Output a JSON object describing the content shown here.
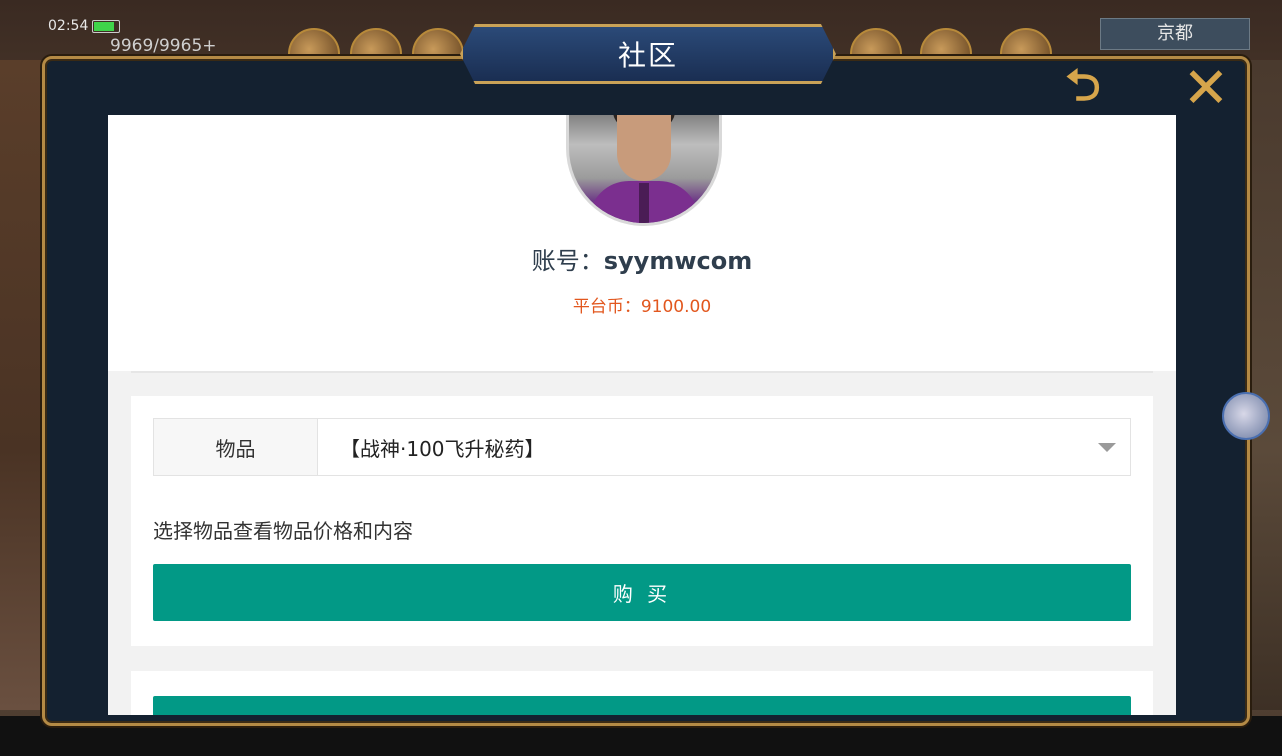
{
  "status_bar": {
    "time": "02:54",
    "resource": "9969/9965+",
    "city": "京都"
  },
  "dialog": {
    "title": "社区",
    "back_icon": "return-arrow-icon",
    "close_icon": "close-x-icon"
  },
  "profile": {
    "avatar_icon": "user-avatar",
    "account_label": "账号：",
    "account_value": "syymwcom",
    "balance_label": "平台币：",
    "balance_value": "9100.00"
  },
  "purchase": {
    "item_label": "物品",
    "selected_item": "【战神·100飞升秘药】",
    "hint": "选择物品查看物品价格和内容",
    "buy_label": "购 买"
  },
  "colors": {
    "accent": "#029986",
    "balance": "#e2571e",
    "frame_gold": "#b48a45",
    "frame_dark": "#142130"
  }
}
